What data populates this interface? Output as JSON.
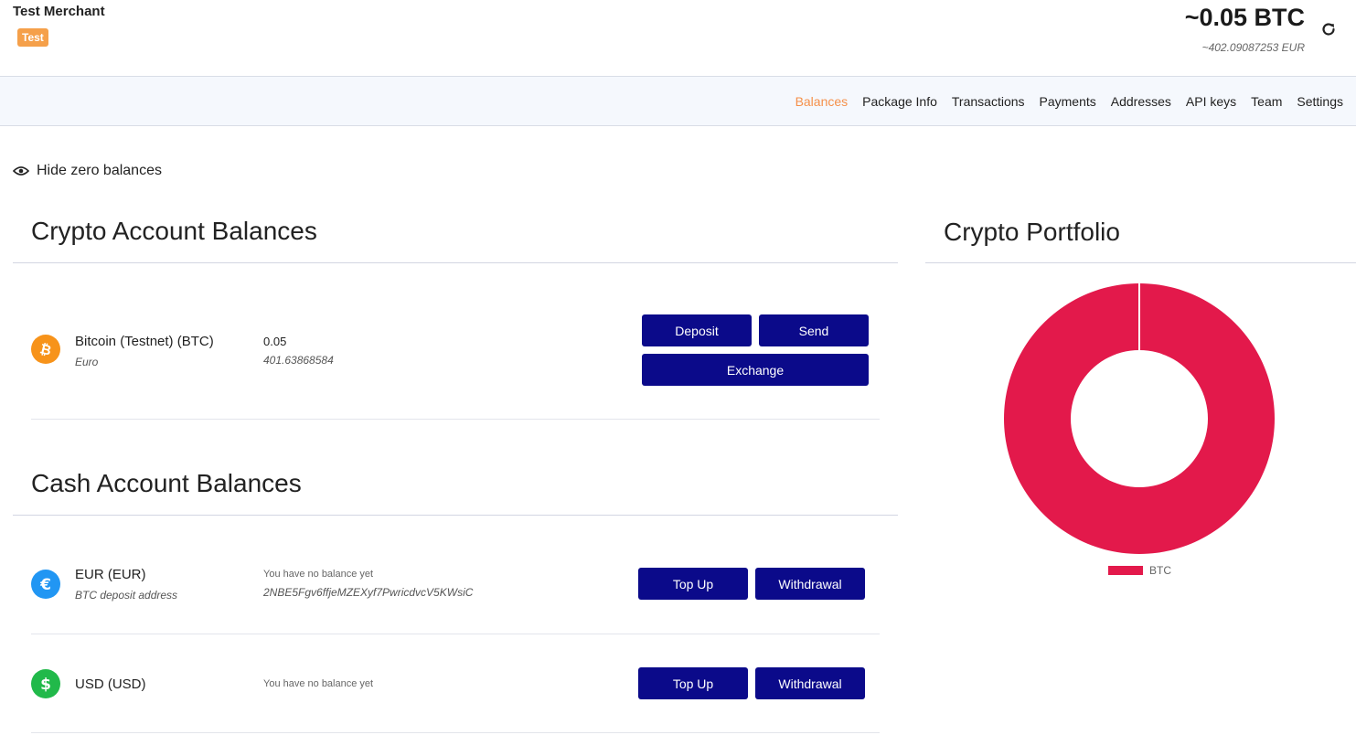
{
  "header": {
    "merchant_name": "Test Merchant",
    "badge": "Test",
    "total_btc": "~0.05 BTC",
    "total_eur": "~402.09087253 EUR"
  },
  "nav": {
    "items": [
      "Balances",
      "Package Info",
      "Transactions",
      "Payments",
      "Addresses",
      "API keys",
      "Team",
      "Settings"
    ],
    "active": "Balances"
  },
  "hide_zero": {
    "label": "Hide zero balances"
  },
  "crypto": {
    "title": "Crypto Account Balances",
    "accounts": [
      {
        "name": "Bitcoin (Testnet) (BTC)",
        "sub": "Euro",
        "value": "0.05",
        "value_sub": "401.63868584",
        "buttons": {
          "deposit": "Deposit",
          "send": "Send",
          "exchange": "Exchange"
        }
      }
    ]
  },
  "cash": {
    "title": "Cash Account Balances",
    "accounts": [
      {
        "name": "EUR (EUR)",
        "sub": "BTC deposit address",
        "no_balance": "You have no balance yet",
        "address": "2NBE5Fgv6ffjeMZEXyf7PwricdvcV5KWsiC",
        "buttons": {
          "topup": "Top Up",
          "withdrawal": "Withdrawal"
        }
      },
      {
        "name": "USD (USD)",
        "no_balance": "You have no balance yet",
        "buttons": {
          "topup": "Top Up",
          "withdrawal": "Withdrawal"
        }
      }
    ]
  },
  "portfolio": {
    "title": "Crypto Portfolio"
  },
  "chart_data": {
    "type": "pie",
    "categories": [
      "BTC"
    ],
    "values": [
      0.05
    ],
    "colors": [
      "#e3194b"
    ],
    "legend": [
      "BTC"
    ],
    "legend_position": "bottom"
  },
  "colors": {
    "accent": "#f5904a",
    "button": "#0b0a8a",
    "btc_icon": "#f7931a",
    "eur_icon": "#2196f3",
    "usd_icon": "#21b94a",
    "chart_btc": "#e3194b"
  }
}
